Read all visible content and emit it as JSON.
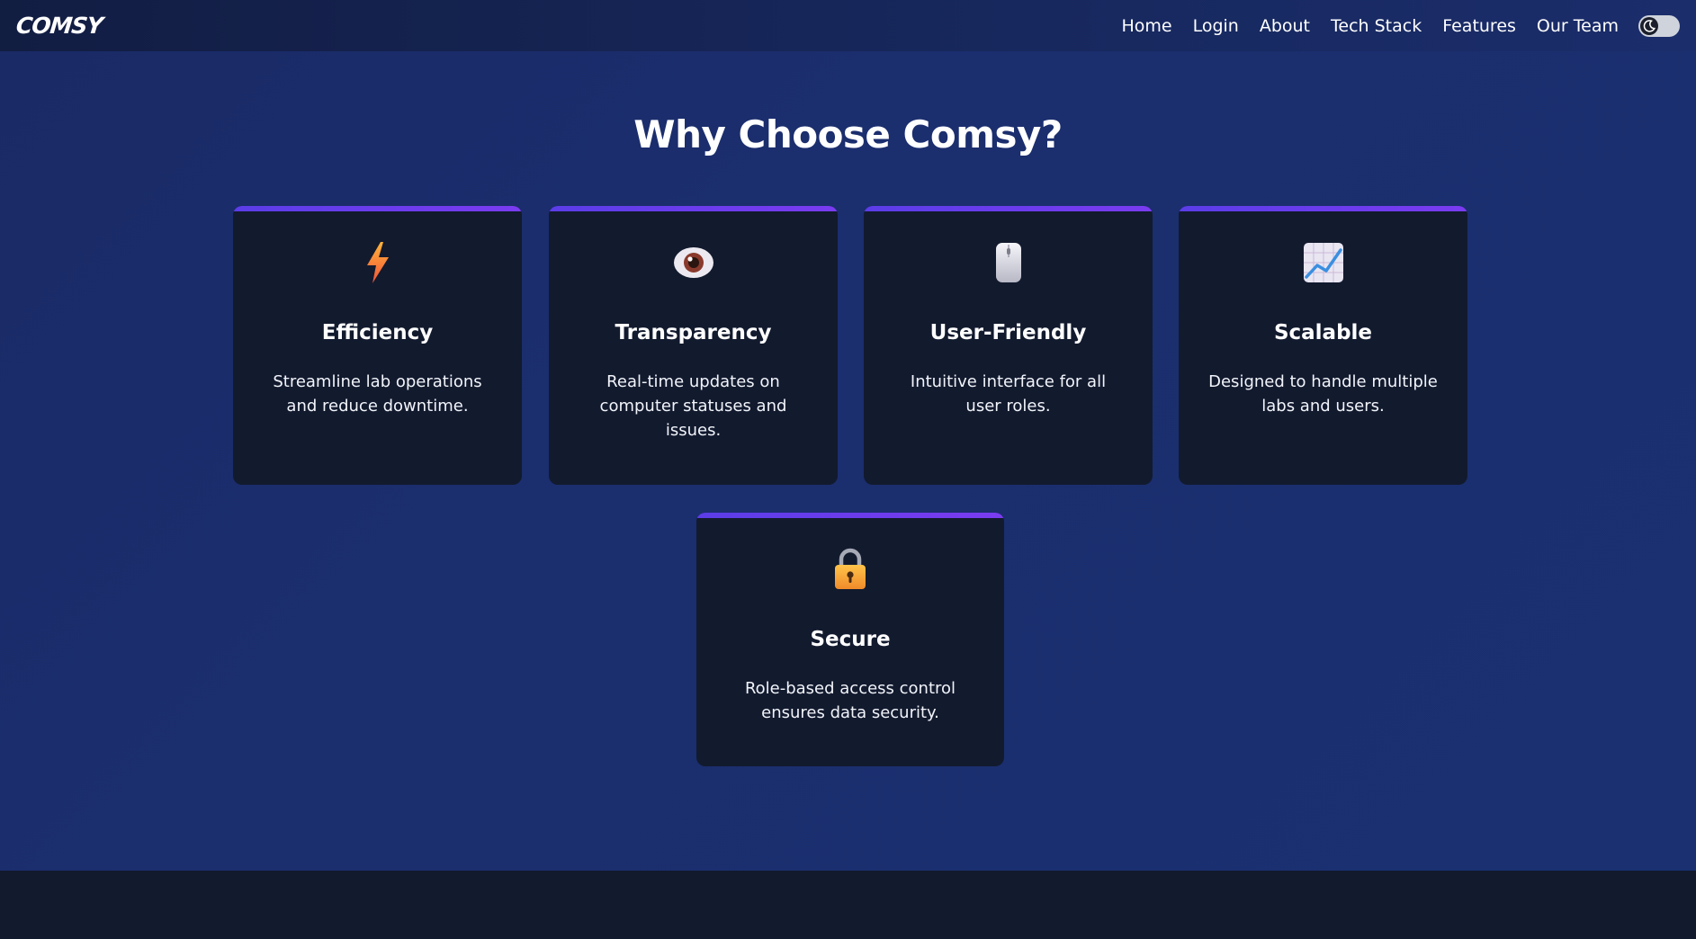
{
  "brand": {
    "logo_text": "COMSY"
  },
  "nav": {
    "links": [
      "Home",
      "Login",
      "About",
      "Tech Stack",
      "Features",
      "Our Team"
    ],
    "theme_toggle_icon": "moon-icon"
  },
  "section": {
    "title": "Why Choose Comsy?"
  },
  "features": [
    {
      "icon": "lightning-icon",
      "title": "Efficiency",
      "text": "Streamline lab operations and reduce downtime."
    },
    {
      "icon": "eye-icon",
      "title": "Transparency",
      "text": "Real-time updates on computer statuses and issues."
    },
    {
      "icon": "mouse-icon",
      "title": "User-Friendly",
      "text": "Intuitive interface for all user roles."
    },
    {
      "icon": "chart-increasing-icon",
      "title": "Scalable",
      "text": "Designed to handle multiple labs and users."
    },
    {
      "icon": "lock-icon",
      "title": "Secure",
      "text": "Role-based access control ensures data security."
    }
  ],
  "colors": {
    "background": "#1b2e6e",
    "card": "#121a2e",
    "card_accent": "#6a3cec",
    "footer": "#121a2d"
  }
}
